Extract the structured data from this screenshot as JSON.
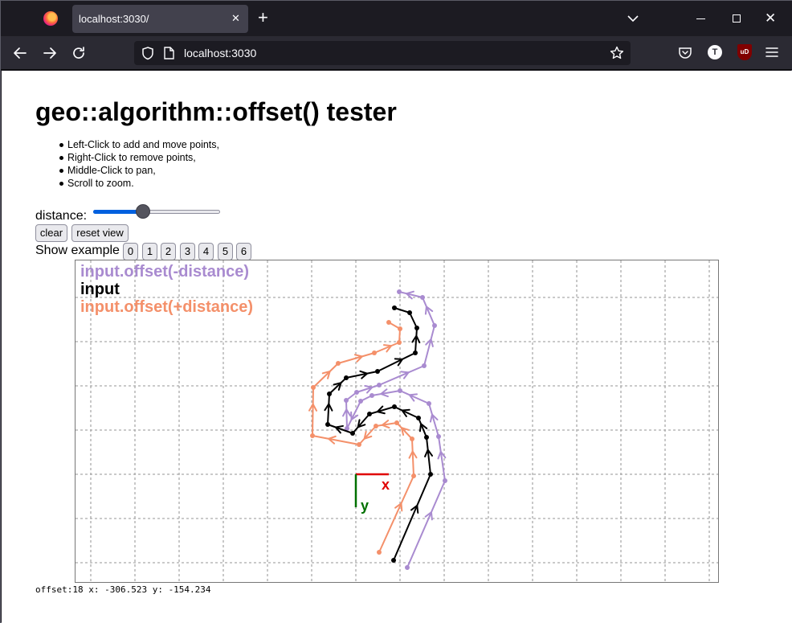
{
  "browser": {
    "tab_title": "localhost:3030/",
    "tab_close_glyph": "✕",
    "new_tab_glyph": "+",
    "window_close_glyph": "✕",
    "url": "localhost:3030",
    "profile_initial": "T",
    "ublock_label": "uD",
    "icons": [
      "firefox-logo",
      "back-arrow",
      "forward-arrow",
      "reload",
      "shield",
      "page",
      "bookmark-star",
      "pocket",
      "profile-avatar",
      "ublock-origin",
      "hamburger-menu"
    ]
  },
  "page": {
    "title": "geo::algorithm::offset() tester",
    "instructions": [
      "Left-Click to add and move points,",
      "Right-Click to remove points,",
      "Middle-Click to pan,",
      "Scroll to zoom."
    ],
    "distance_label": "distance:",
    "distance_slider_fraction": 0.38,
    "clear_label": "clear",
    "reset_view_label": "reset view",
    "show_example_label": "Show example",
    "examples": [
      "0",
      "1",
      "2",
      "3",
      "4",
      "5",
      "6"
    ],
    "status": "offset:18 x: -306.523 y: -154.234"
  },
  "canvas": {
    "legend": {
      "minus": "input.offset(-distance)",
      "input": "input",
      "plus": "input.offset(+distance)"
    },
    "axis_x_label": "x",
    "axis_y_label": "y",
    "colors": {
      "minus": "#a98bd0",
      "input": "#000000",
      "plus": "#f4906a",
      "axis_x": "#e00000",
      "axis_y": "#007000",
      "grid": "#aaaaaa"
    },
    "series": {
      "input": [
        [
          488,
          696
        ],
        [
          534,
          589
        ],
        [
          529,
          543
        ],
        [
          519,
          519
        ],
        [
          489,
          505
        ],
        [
          458,
          514
        ],
        [
          437,
          538
        ],
        [
          406,
          527
        ],
        [
          408,
          489
        ],
        [
          429,
          469
        ],
        [
          468,
          461
        ],
        [
          515,
          438
        ],
        [
          517,
          407
        ],
        [
          508,
          388
        ],
        [
          489,
          382
        ]
      ],
      "minus": [
        [
          505,
          705
        ],
        [
          552,
          597
        ],
        [
          544,
          542
        ],
        [
          532,
          501
        ],
        [
          496,
          485
        ],
        [
          461,
          491
        ],
        [
          447,
          498
        ],
        [
          430,
          532
        ],
        [
          429,
          497
        ],
        [
          442,
          487
        ],
        [
          470,
          478
        ],
        [
          526,
          454
        ],
        [
          539,
          404
        ],
        [
          524,
          369
        ],
        [
          495,
          362
        ]
      ],
      "plus": [
        [
          470,
          686
        ],
        [
          513,
          591
        ],
        [
          511,
          545
        ],
        [
          492,
          525
        ],
        [
          466,
          529
        ],
        [
          445,
          552
        ],
        [
          387,
          541
        ],
        [
          388,
          481
        ],
        [
          419,
          451
        ],
        [
          464,
          438
        ],
        [
          495,
          425
        ],
        [
          496,
          408
        ],
        [
          482,
          400
        ]
      ]
    }
  }
}
